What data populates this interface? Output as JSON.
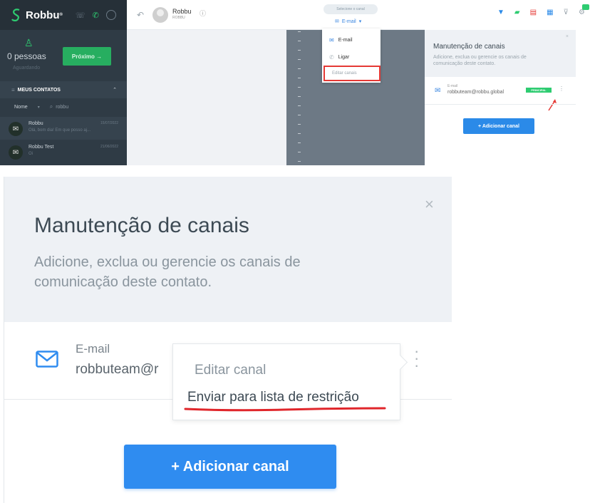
{
  "app": {
    "brand": "Robbu"
  },
  "queue": {
    "count_label": "0 pessoas",
    "waiting_label": "Aguardando",
    "next_button": "Próximo →"
  },
  "contacts": {
    "section_title": "MEUS CONTATOS",
    "filter_label": "Nome",
    "search_value": "robbu",
    "items": [
      {
        "name": "Robbu",
        "message": "Olá, bom dia! Em que posso aj...",
        "date": "15/07/2022"
      },
      {
        "name": "Robbu Test",
        "message": "Oi",
        "date": "21/06/2022"
      }
    ]
  },
  "conversation": {
    "contact_name": "Robbu",
    "contact_sub": "ROBBU",
    "channel_select_label": "Selecione o canal",
    "current_channel": "E-mail"
  },
  "channel_dropdown": {
    "items": [
      "E-mail",
      "Ligar"
    ],
    "edit_label": "Editar canais"
  },
  "panel": {
    "title": "Manutenção de canais",
    "description": "Adicione, exclua ou gerencie os canais de comunicação deste contato.",
    "channel_label": "E-mail",
    "channel_value": "robbuteam@robbu.global",
    "channel_value_truncated": "robbuteam@r",
    "badge": "PRINCIPAL",
    "add_button": "+ Adicionar canal",
    "close": "×"
  },
  "context_menu": {
    "edit": "Editar canal",
    "restrict": "Enviar para lista de restrição"
  },
  "colors": {
    "sidebar": "#2f3b45",
    "accent_green": "#2ecc71",
    "accent_blue": "#2f8cf0",
    "highlight_red": "#e53935"
  }
}
